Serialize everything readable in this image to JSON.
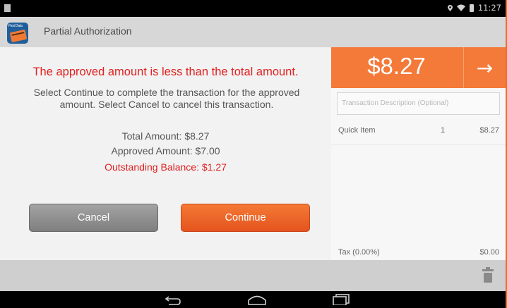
{
  "status_bar": {
    "time": "11:27",
    "icons": [
      "location-icon",
      "wifi-icon",
      "battery-icon"
    ]
  },
  "app": {
    "title": "Partial Authorization",
    "icon_brand": "First Data"
  },
  "dialog": {
    "heading": "The approved amount is less than the total amount.",
    "body": "Select Continue to complete the transaction for the approved amount. Select Cancel to cancel this transaction.",
    "total_amount": "Total Amount: $8.27",
    "approved_amount": "Approved Amount: $7.00",
    "outstanding_balance": "Outstanding Balance: $1.27",
    "cancel_label": "Cancel",
    "continue_label": "Continue"
  },
  "order": {
    "amount": "$8.27",
    "description_placeholder": "Transaction Description (Optional)",
    "items": [
      {
        "name": "Quick Item",
        "qty": "1",
        "price": "$8.27"
      }
    ],
    "tax_label": "Tax (0.00%)",
    "tax_value": "$0.00"
  },
  "colors": {
    "accent": "#f47a3a",
    "alert": "#e02020"
  }
}
